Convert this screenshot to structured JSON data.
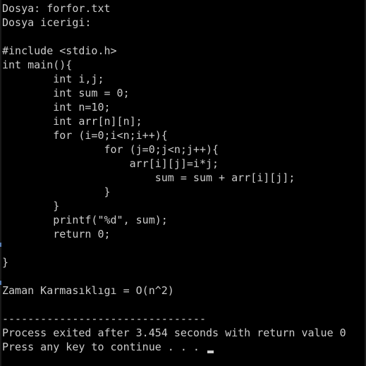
{
  "console": {
    "background": "#000000",
    "text_color": "#cccccc",
    "header": {
      "file_label": "Dosya: forfor.txt",
      "content_label": "Dosya icerigi:"
    },
    "code_lines": [
      "#include <stdio.h>",
      "int main(){",
      "        int i,j;",
      "        int sum = 0;",
      "        int n=10;",
      "        int arr[n][n];",
      "        for (i=0;i<n;i++){",
      "                for (j=0;j<n;j++){",
      "                    arr[i][j]=i*j;",
      "                        sum = sum + arr[i][j];",
      "                }",
      "        }",
      "        printf(\"%d\", sum);",
      "        return 0;",
      "",
      "}"
    ],
    "complexity": "Zaman Karmasıklıgı = O(n^2)",
    "separator": "--------------------------------",
    "exit_message": "Process exited after 3.454 seconds with return value 0",
    "continue_prompt": "Press any key to continue . . . "
  }
}
